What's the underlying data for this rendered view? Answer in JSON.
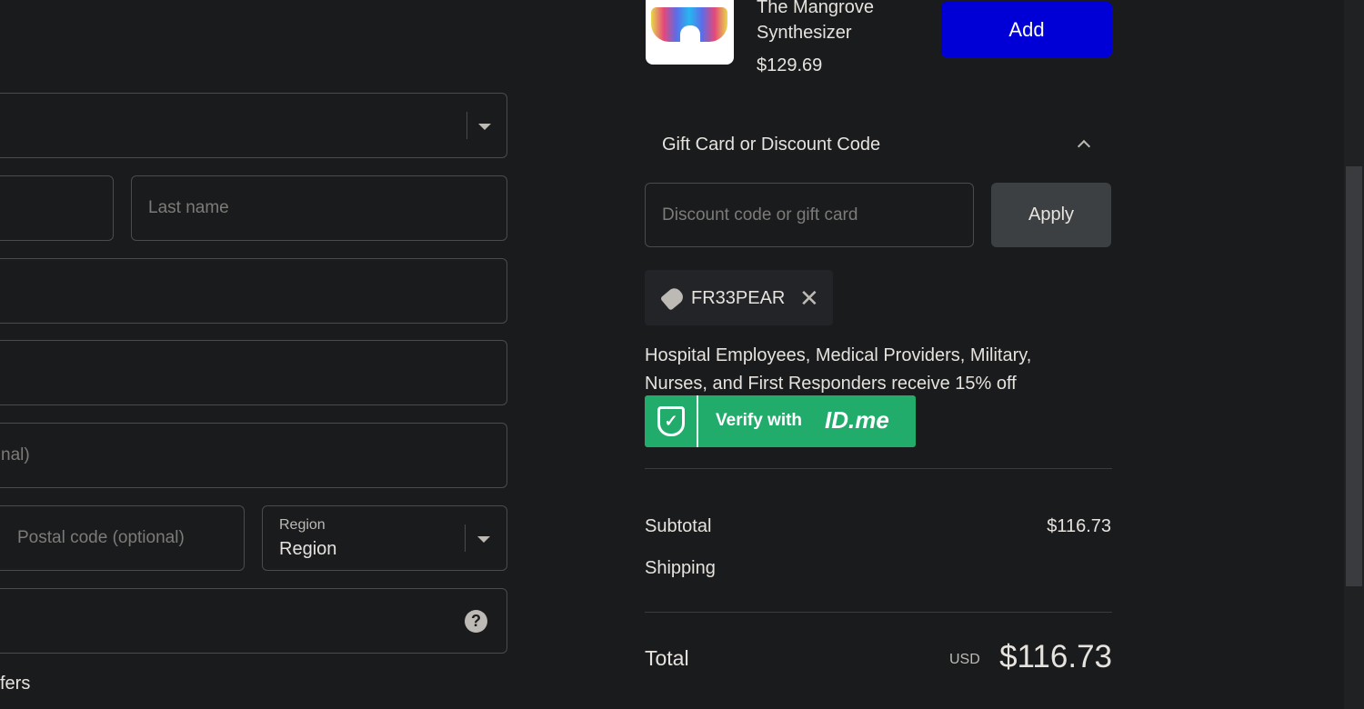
{
  "form": {
    "last_name_placeholder": "Last name",
    "address2_placeholder_partial": "nal)",
    "postal_placeholder": "Postal code (optional)",
    "region_label": "Region",
    "region_value": "Region",
    "offers_partial": "fers"
  },
  "upsell": {
    "name_line1": "The Mangrove",
    "name_line2": "Synthesizer",
    "price": "$129.69",
    "add_label": "Add",
    "add_color": "#0000d6"
  },
  "discount": {
    "heading": "Gift Card or Discount Code",
    "placeholder": "Discount code or gift card",
    "apply_label": "Apply",
    "applied_code": "FR33PEAR",
    "promo_text": "Hospital Employees, Medical Providers, Military, Nurses, and First Responders receive 15% off",
    "verify_label": "Verify with",
    "verify_brand": "ID.me",
    "verify_color": "#21ac6b"
  },
  "summary": {
    "subtotal_label": "Subtotal",
    "subtotal_value": "$116.73",
    "shipping_label": "Shipping",
    "total_label": "Total",
    "currency": "USD",
    "total_value": "$116.73"
  }
}
